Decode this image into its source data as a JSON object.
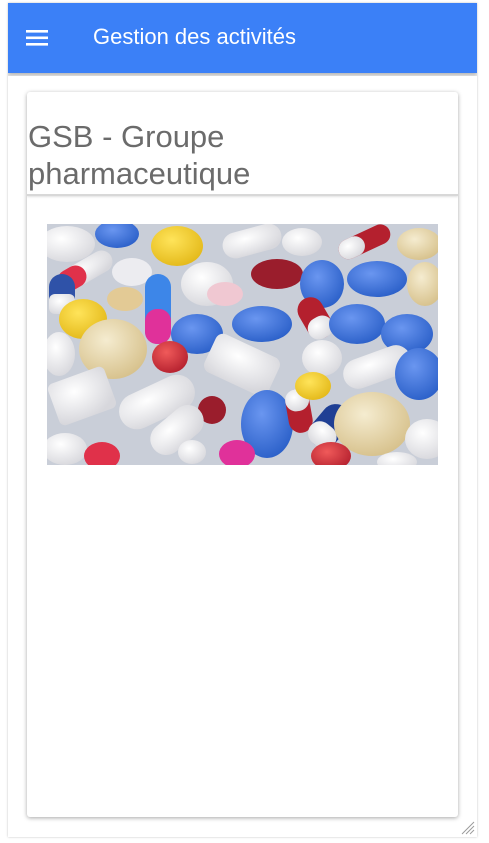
{
  "toolbar": {
    "title": "Gestion des activités",
    "menu_icon": "menu-icon",
    "background_color": "#3b80f7",
    "text_color": "#ffffff"
  },
  "card": {
    "title": "GSB - Groupe pharmaceutique",
    "title_color": "#6b6b6b",
    "image": {
      "description_icon": "pills-photo",
      "palette": [
        "#2f6fd6",
        "#f3d23a",
        "#e0314a",
        "#ffffff",
        "#9a1d2c",
        "#e8d9a8",
        "#6a8fe8"
      ]
    }
  },
  "window": {
    "resize_icon": "resize-grip-icon"
  }
}
